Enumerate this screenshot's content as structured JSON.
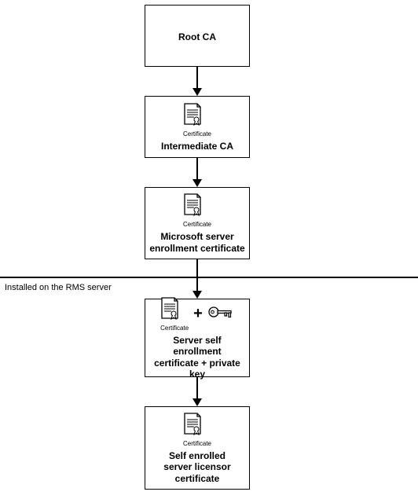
{
  "chart_data": {
    "type": "flow",
    "nodes": [
      {
        "id": "root",
        "label": "Root CA",
        "icon": null
      },
      {
        "id": "inter",
        "label": "Intermediate CA",
        "icon": "certificate"
      },
      {
        "id": "msenr",
        "label": "Microsoft server enrollment certificate",
        "icon": "certificate"
      },
      {
        "id": "selfen",
        "label": "Server self enrollment certificate + private key",
        "icon": "certificate+key"
      },
      {
        "id": "selflc",
        "label": "Self enrolled server licensor certificate",
        "icon": "certificate"
      }
    ],
    "edges": [
      [
        "root",
        "inter"
      ],
      [
        "inter",
        "msenr"
      ],
      [
        "msenr",
        "selfen"
      ],
      [
        "selfen",
        "selflc"
      ]
    ],
    "separator": {
      "after_node": "msenr",
      "label": "Installed on the RMS server"
    }
  },
  "labels": {
    "root": "Root CA",
    "inter": "Intermediate CA",
    "msenr1": "Microsoft server",
    "msenr2": "enrollment certificate",
    "selfen1": "Server self enrollment",
    "selfen2": "certificate + private key",
    "selflc1": "Self enrolled",
    "selflc2": "server licensor",
    "selflc3": "certificate",
    "cert": "Certificate",
    "plus": "+",
    "side": "Installed on the RMS server"
  }
}
